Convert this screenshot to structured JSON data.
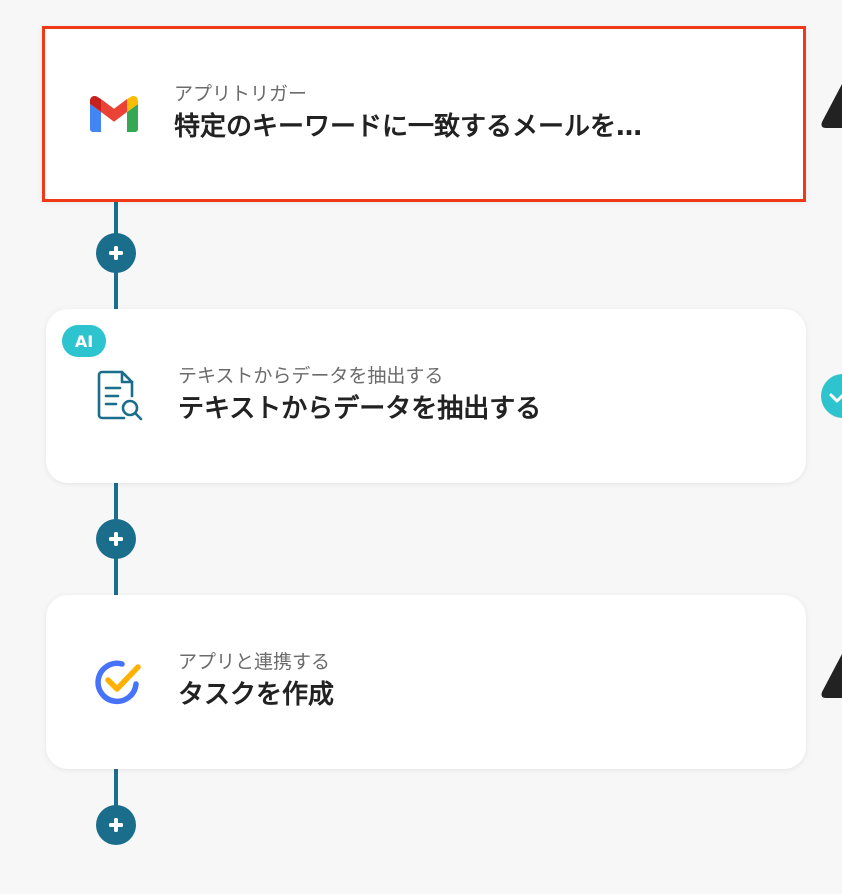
{
  "flow": {
    "steps": [
      {
        "subtitle": "アプリトリガー",
        "title": "特定のキーワードに一致するメールを…",
        "icon": "gmail-icon",
        "selected": true
      },
      {
        "badge": "AI",
        "subtitle": "テキストからデータを抽出する",
        "title": "テキストからデータを抽出する",
        "icon": "document-search-icon"
      },
      {
        "subtitle": "アプリと連携する",
        "title": "タスクを作成",
        "icon": "ticktick-icon"
      }
    ]
  },
  "colors": {
    "connector": "#1a6e8c",
    "selection_border": "#f03a17",
    "ai_badge": "#2ec4cf",
    "background": "#f7f7f7",
    "card": "#ffffff"
  },
  "icons": {
    "add_button": "plus-icon",
    "right_edge_top": "warning-triangle-icon",
    "right_edge_middle": "check-circle-icon",
    "right_edge_bottom": "warning-triangle-icon"
  }
}
